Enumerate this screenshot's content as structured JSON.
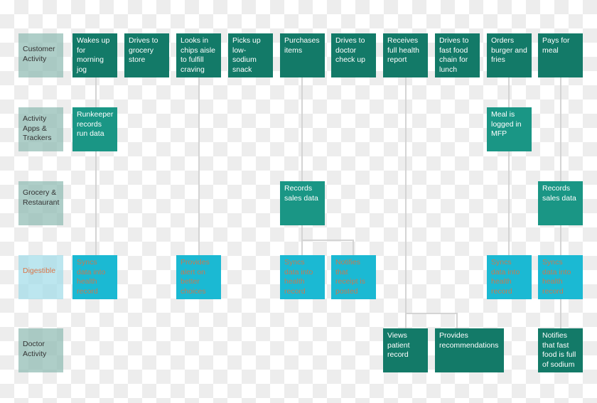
{
  "rows": {
    "customer": "Customer Activity",
    "apps": "Activity Apps & Trackers",
    "grocery": "Grocery & Restaurant",
    "digestible": "Digestible",
    "doctor": "Doctor Activity"
  },
  "customer_activity": [
    "Wakes up for morning jog",
    "Drives to grocery store",
    "Looks in chips aisle to fulfill craving",
    "Picks up low-sodium snack",
    "Purchases items",
    "Drives to doctor check up",
    "Receives full health report",
    "Drives to fast food chain for lunch",
    "Orders burger and fries",
    "Pays for meal"
  ],
  "apps_trackers": {
    "runkeeper": "Runkeeper records run data",
    "mfp": "Meal is logged in MFP"
  },
  "grocery_restaurant": {
    "grocery_sales": "Records sales data",
    "restaurant_sales": "Records sales data"
  },
  "digestible": {
    "sync_run": "Syncs data into health record",
    "alert": "Provides alert on better choices",
    "sync_sales": "Syncs data into health record",
    "receipt": "Notifies that receipt is posted",
    "sync_meal": "Syncs data into health record",
    "sync_restaurant": "Syncs data into health record"
  },
  "doctor_activity": {
    "views": "Views patient record",
    "recommend": "Provides recommendations",
    "notifies": "Notifies that fast food is full of sodium"
  },
  "colors": {
    "customer": "#137a68",
    "apps_grocery": "#1a9685",
    "digestible": "#1bb9d3",
    "digestible_text": "#c27c55",
    "connector": "#d4d4d4"
  }
}
